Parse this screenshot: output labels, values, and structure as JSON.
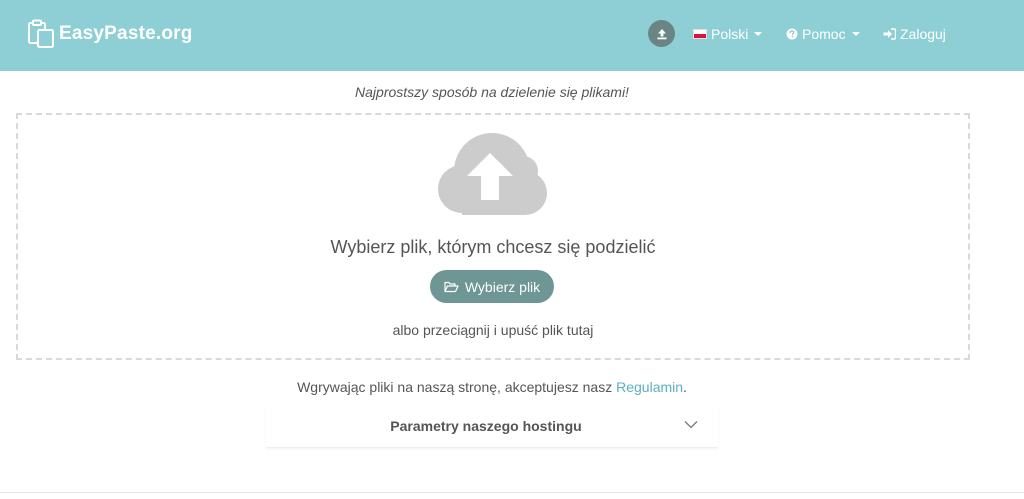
{
  "navbar": {
    "brand": "EasyPaste.org",
    "language_label": "Polski",
    "help_label": "Pomoc",
    "login_label": "Zaloguj",
    "background_color": "#8ecfd5",
    "icons": [
      "clipboard-logo-icon",
      "upload-icon",
      "flag-pl-icon",
      "question-circle-icon",
      "sign-in-icon"
    ]
  },
  "main": {
    "tagline": "Najprostszy sposób na dzielenie się plikami!",
    "dropzone": {
      "title": "Wybierz plik, którym chcesz się podzielić",
      "button_label": "Wybierz plik",
      "drag_text": "albo przeciągnij i upuść plik tutaj",
      "icon": "cloud-upload-icon"
    },
    "terms": {
      "text": "Wgrywając pliki na naszą stronę, akceptujesz nasz",
      "link_label": "Regulamin",
      "suffix": "."
    },
    "params": {
      "title": "Parametry naszego hostingu"
    }
  },
  "colors": {
    "accent": "#8ecfd5",
    "button": "#6e9694",
    "link": "#5bb0c0"
  }
}
